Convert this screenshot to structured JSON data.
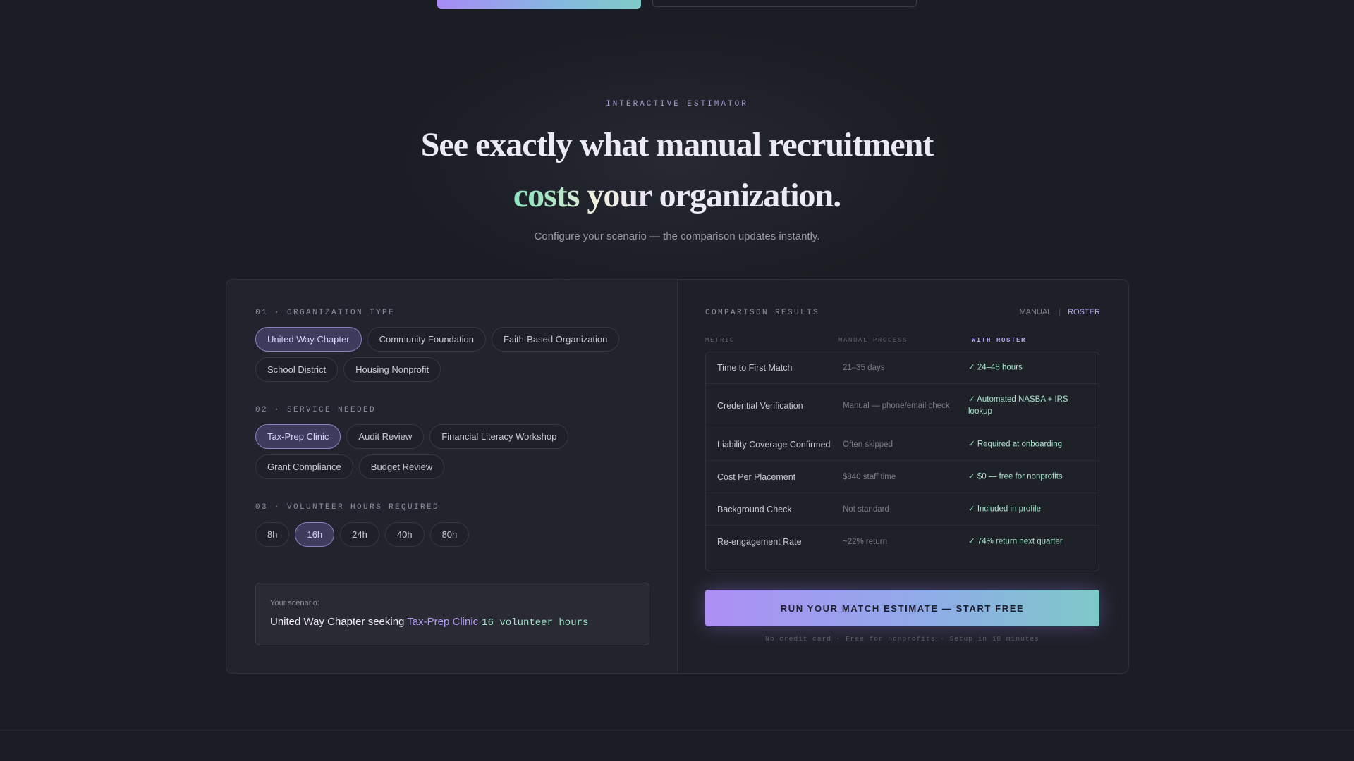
{
  "hero": {
    "eyebrow": "INTERACTIVE ESTIMATOR",
    "headline_line1": "See exactly what manual recruitment",
    "headline_accent": "costs your",
    "headline_rest": "organization.",
    "subhead": "Configure your scenario — the comparison updates instantly."
  },
  "config": {
    "org_label": "01 · ORGANIZATION TYPE",
    "org_options": [
      "United Way Chapter",
      "Community Foundation",
      "Faith-Based Organization",
      "School District",
      "Housing Nonprofit"
    ],
    "org_selected": "United Way Chapter",
    "service_label": "02 · SERVICE NEEDED",
    "service_options": [
      "Tax-Prep Clinic",
      "Audit Review",
      "Financial Literacy Workshop",
      "Grant Compliance",
      "Budget Review"
    ],
    "service_selected": "Tax-Prep Clinic",
    "hours_label": "03 · VOLUNTEER HOURS REQUIRED",
    "hours_options": [
      "8h",
      "16h",
      "24h",
      "40h",
      "80h"
    ],
    "hours_selected": "16h",
    "scenario": {
      "label": "Your scenario:",
      "org": "United Way Chapter",
      "seeking": "seeking",
      "service": "Tax-Prep Clinic",
      "sep": "·",
      "hours": "16 volunteer hours"
    }
  },
  "results": {
    "title": "COMPARISON RESULTS",
    "toggle_off": "MANUAL",
    "toggle_sep": "|",
    "toggle_on": "ROSTER",
    "headers": {
      "metric": "METRIC",
      "manual": "MANUAL PROCESS",
      "roster": "WITH ROSTER"
    },
    "check": "✓",
    "rows": [
      {
        "metric": "Time to First Match",
        "manual": "21–35 days",
        "roster": "24–48 hours"
      },
      {
        "metric": "Credential Verification",
        "manual": "Manual — phone/email check",
        "roster": "Automated NASBA + IRS lookup"
      },
      {
        "metric": "Liability Coverage Confirmed",
        "manual": "Often skipped",
        "roster": "Required at onboarding"
      },
      {
        "metric": "Cost Per Placement",
        "manual": "$840 staff time",
        "roster": "$0 — free for nonprofits"
      },
      {
        "metric": "Background Check",
        "manual": "Not standard",
        "roster": "Included in profile"
      },
      {
        "metric": "Re-engagement Rate",
        "manual": "~22% return",
        "roster": "74% return next quarter"
      }
    ],
    "cta": "RUN YOUR MATCH ESTIMATE — START FREE",
    "fine_print": "No credit card · Free for nonprofits · Setup in 10 minutes"
  },
  "colors": {
    "background": "#1b1d24",
    "accent_purple": "#ad8ff5",
    "accent_teal": "#7ecac7",
    "roster_green": "#a9e5cd"
  }
}
